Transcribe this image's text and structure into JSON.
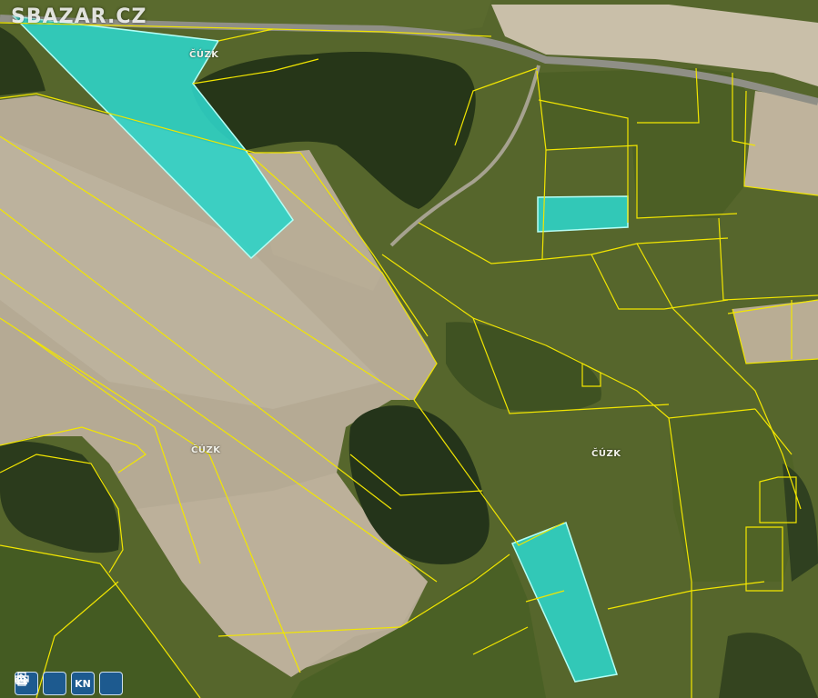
{
  "watermark": "SBAZAR.CZ",
  "cuzk_labels": [
    "ČÚZK",
    "ČÚZK",
    "ČÚZK"
  ],
  "toolbar": {
    "buttons": [
      {
        "icon": "map-icon",
        "label": ""
      },
      {
        "icon": "print-icon",
        "label": ""
      },
      {
        "icon": "",
        "label": "KN"
      },
      {
        "icon": "share-icon",
        "label": ""
      }
    ]
  },
  "colors": {
    "parcel_line": "#f2e600",
    "highlight_fill": "#2fd3c6",
    "highlight_stroke": "#b5fff6",
    "forest": "#2a3a18",
    "meadow": "#5f7030",
    "field": "#b3a994",
    "button": "#1d5a8f"
  }
}
